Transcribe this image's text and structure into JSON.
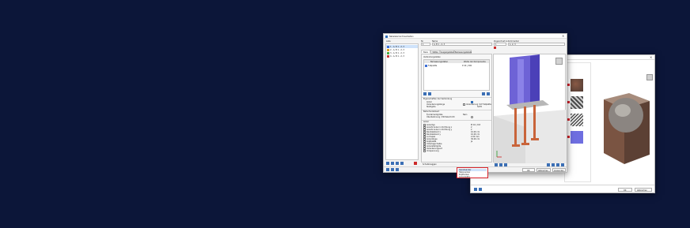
{
  "main_window": {
    "title": "Nabelelement bearbeiten",
    "tree_header": "Liste",
    "tree_items": [
      "1 - A, B  1 - 2, 3",
      "2 - A, B  1 - 2, 3",
      "3 - A, B  1 - 2, 3",
      "4 - A, B  1 - 2, 3"
    ],
    "field_no_label": "Nr.",
    "field_no_value": "1",
    "field_name_label": "Name",
    "field_name_value": "A, B  1 - 2, 3",
    "field_assign_label": "Zugeordnet zu",
    "field_assign_value": "1",
    "field_comment_label": "Kommentar",
    "field_comment_value": "1, 2, 3",
    "tabs": [
      "Basis",
      "Stütze",
      "Ausgangsdaten",
      "Bemessungsdetails"
    ],
    "table_section_label": "Verbindungsdaten",
    "table_headers": [
      "Bemessungsdaten",
      "Werte der Komponente"
    ],
    "table_row": [
      "Fußplatte",
      "P 20 | 300"
    ],
    "group_props": "Eigenschaften der Verbindung",
    "prop_rows": [
      {
        "label": "Anker",
        "value": ""
      },
      {
        "label": "Verankerungslänge",
        "value": "10.00 cm"
      },
      {
        "label": "Stahlgüte",
        "value": "S235"
      }
    ],
    "prop_checkbox_label": "Verankerung mit Fußplatte",
    "group_concrete": "Betonfundament",
    "concrete_rows": [
      {
        "label": "Fundamentgröße",
        "value": "Nein"
      },
      {
        "label": "Überbetonung / Mörtelschicht",
        "value": ""
      }
    ],
    "group_anchor": "Anker",
    "anchor_rows": [
      {
        "label": "Ankertyp",
        "value": "M 16 | 8.8"
      },
      {
        "label": "Anzahl Anker in Richtung x",
        "value": "2"
      },
      {
        "label": "Anzahl Anker in Richtung y",
        "value": "2"
      },
      {
        "label": "Randabstand x",
        "value": "10.00 cm"
      },
      {
        "label": "Randabstand y",
        "value": "10.00 cm"
      },
      {
        "label": "Lochspiel",
        "value": "2.00 mm"
      },
      {
        "label": "Ankerlänge",
        "value": "30.00 cm"
      },
      {
        "label": "Kopfplatte",
        "value": "Ja"
      },
      {
        "label": "Unterlegscheibe",
        "value": ""
      },
      {
        "label": "Ankerstahlgüte",
        "value": ""
      },
      {
        "label": "Verankerungsart",
        "value": ""
      },
      {
        "label": "Vorspannung",
        "value": ""
      }
    ],
    "dropdown_options": [
      "Geradeanker",
      "Hakenanker",
      "Kopfbolzen",
      "Ankerplatte"
    ],
    "group_shear": "Schubknaggen",
    "shear_rows": [
      {
        "label": "Typ",
        "value": "1.00 m"
      },
      {
        "label": "Länge",
        "value": "1.00 m"
      }
    ],
    "button_ok": "OK",
    "button_cancel": "Abbrechen",
    "button_apply": "Anwenden"
  },
  "back_window": {
    "title": "Materialbibliothek",
    "thumbnails": 4,
    "button_ok": "OK",
    "button_cancel": "Abbrechen"
  },
  "colors": {
    "background": "#0c1639",
    "column": "#6e63d6",
    "anchor": "#c9643a",
    "selection_red": "#d8242c"
  }
}
